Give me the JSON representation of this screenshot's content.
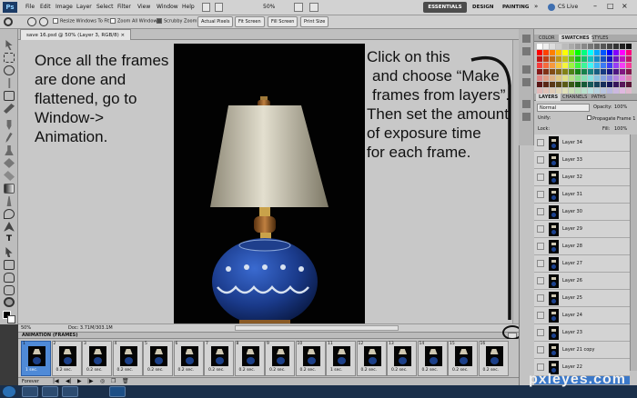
{
  "app": {
    "logo": "Ps",
    "menu": [
      "File",
      "Edit",
      "Image",
      "Layer",
      "Select",
      "Filter",
      "View",
      "Window",
      "Help"
    ],
    "zoom_select": "50%",
    "workspaces": [
      "ESSENTIALS",
      "DESIGN",
      "PAINTING"
    ],
    "more_workspaces": "»",
    "cs_live": "CS Live"
  },
  "options": {
    "resize_windows": "Resize Windows To Fit",
    "zoom_all": "Zoom All Windows",
    "scrubby": "Scrubby Zoom",
    "actual_pixels": "Actual Pixels",
    "fit_screen": "Fit Screen",
    "fill_screen": "Fill Screen",
    "print_size": "Print Size"
  },
  "document": {
    "tab_title": "save 16.psd @ 50% (Layer 3, RGB/8)",
    "status_zoom": "50%",
    "status_doc": "Doc: 3.71M/303.1M"
  },
  "instructions": {
    "left": [
      "Once all the frames",
      "are done and",
      "flattened, go to",
      "Window->",
      "Animation."
    ],
    "right": [
      "Click on this",
      "and choose “Make",
      "frames from layers”.",
      "Then set the amount",
      "of exposure time",
      "for each frame."
    ]
  },
  "animation": {
    "title": "ANIMATION (FRAMES)",
    "loop": "Forever",
    "frames": [
      {
        "n": "1",
        "delay": "1 sec.",
        "selected": true
      },
      {
        "n": "2",
        "delay": "0.2 sec."
      },
      {
        "n": "3",
        "delay": "0.2 sec."
      },
      {
        "n": "4",
        "delay": "0.2 sec."
      },
      {
        "n": "5",
        "delay": "0.2 sec."
      },
      {
        "n": "6",
        "delay": "0.2 sec."
      },
      {
        "n": "7",
        "delay": "0.2 sec."
      },
      {
        "n": "8",
        "delay": "0.2 sec."
      },
      {
        "n": "9",
        "delay": "0.2 sec."
      },
      {
        "n": "10",
        "delay": "0.2 sec."
      },
      {
        "n": "11",
        "delay": "1 sec."
      },
      {
        "n": "12",
        "delay": "0.2 sec."
      },
      {
        "n": "13",
        "delay": "0.2 sec."
      },
      {
        "n": "14",
        "delay": "0.2 sec."
      },
      {
        "n": "15",
        "delay": "0.2 sec."
      },
      {
        "n": "16",
        "delay": "0.2 sec."
      }
    ]
  },
  "swatch_panel": {
    "tabs": [
      "COLOR",
      "SWATCHES",
      "STYLES"
    ]
  },
  "layers_panel": {
    "tabs": [
      "LAYERS",
      "CHANNELS",
      "PATHS"
    ],
    "blend_mode": "Normal",
    "opacity_label": "Opacity:",
    "opacity_value": "100%",
    "unify_label": "Unify:",
    "propagate": "Propagate Frame 1",
    "lock_label": "Lock:",
    "fill_label": "Fill:",
    "fill_value": "100%",
    "layers": [
      "Layer 34",
      "Layer 33",
      "Layer 32",
      "Layer 31",
      "Layer 30",
      "Layer 29",
      "Layer 28",
      "Layer 27",
      "Layer 26",
      "Layer 25",
      "Layer 24",
      "Layer 23",
      "Layer 21 copy",
      "Layer 22"
    ]
  },
  "watermark": "pxleyes.com"
}
